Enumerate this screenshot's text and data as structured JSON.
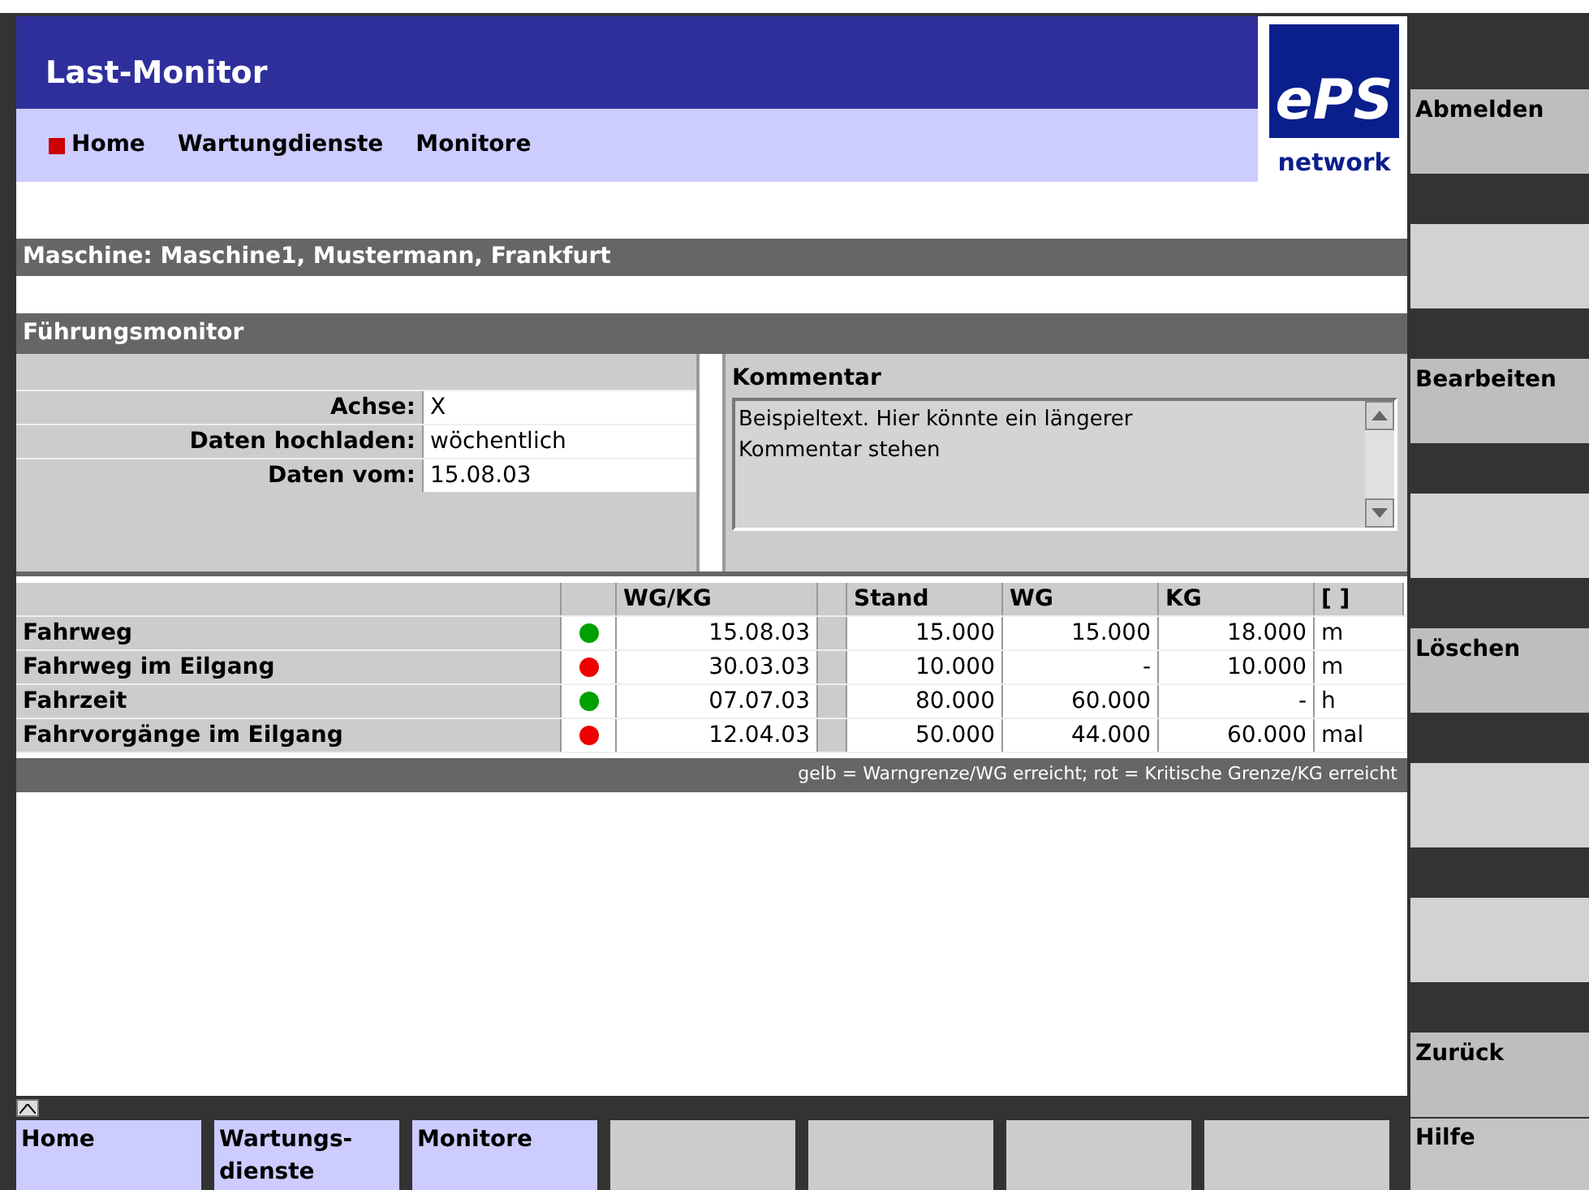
{
  "header": {
    "title": "Last-Monitor",
    "logo": {
      "mark": "ePS",
      "word": "network"
    }
  },
  "nav": [
    {
      "label": "Home",
      "selected": true
    },
    {
      "label": "Wartungdienste",
      "selected": false
    },
    {
      "label": "Monitore",
      "selected": false
    }
  ],
  "machine_bar": "Maschine: Maschine1, Mustermann, Frankfurt",
  "section_bar": "Führungsmonitor",
  "details": [
    {
      "label": "Achse:",
      "value": "X"
    },
    {
      "label": "Daten hochladen:",
      "value": "wöchentlich"
    },
    {
      "label": "Daten vom:",
      "value": "15.08.03"
    }
  ],
  "comment": {
    "title": "Kommentar",
    "value": "Beispieltext. Hier könnte ein längerer Kommentar stehen"
  },
  "table": {
    "columns": [
      "WG/KG",
      "Stand",
      "WG",
      "KG",
      "[ ]"
    ],
    "rows": [
      {
        "name": "Fahrweg",
        "color": "#00a000",
        "date": "15.08.03",
        "stand": "15.000",
        "wg": "15.000",
        "kg": "18.000",
        "unit": "m"
      },
      {
        "name": "Fahrweg im Eilgang",
        "color": "#ee0000",
        "date": "30.03.03",
        "stand": "10.000",
        "wg": "-",
        "kg": "10.000",
        "unit": "m"
      },
      {
        "name": "Fahrzeit",
        "color": "#00a000",
        "date": "07.07.03",
        "stand": "80.000",
        "wg": "60.000",
        "kg": "-",
        "unit": "h"
      },
      {
        "name": "Fahrvorgänge im Eilgang",
        "color": "#ee0000",
        "date": "12.04.03",
        "stand": "50.000",
        "wg": "44.000",
        "kg": "60.000",
        "unit": "mal"
      }
    ]
  },
  "legend": "gelb = Warngrenze/WG erreicht; rot = Kritische Grenze/KG erreicht",
  "bottom_buttons": [
    {
      "label": "Home",
      "enabled": true
    },
    {
      "label": "Wartungs-\ndienste",
      "enabled": true
    },
    {
      "label": "Monitore",
      "enabled": true
    },
    {
      "enabled": false
    },
    {
      "enabled": false
    },
    {
      "enabled": false
    },
    {
      "enabled": false
    }
  ],
  "softkeys": [
    {
      "label": "Abmelden",
      "enabled": true
    },
    {
      "enabled": false
    },
    {
      "label": "Bearbeiten",
      "enabled": true
    },
    {
      "enabled": false
    },
    {
      "label": "Löschen",
      "enabled": true
    },
    {
      "enabled": false
    },
    {
      "enabled": false
    },
    {
      "label": "Zurück",
      "enabled": true
    }
  ],
  "help_button": "Hilfe"
}
